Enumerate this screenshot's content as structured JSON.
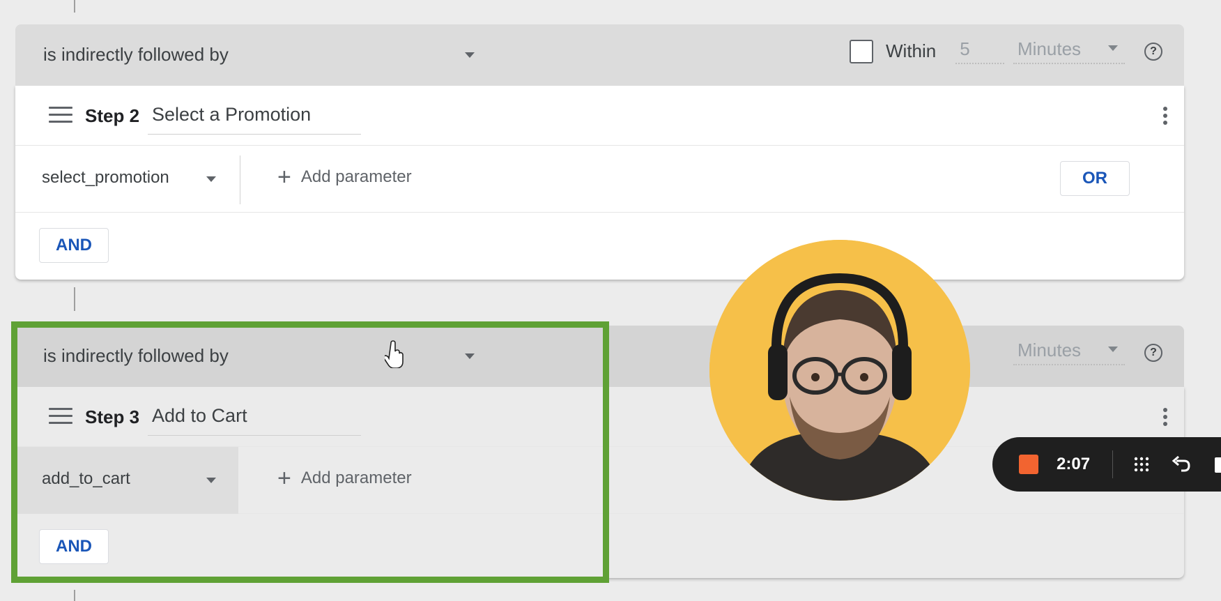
{
  "block1": {
    "condition": "is indirectly followed by",
    "within_label": "Within",
    "within_value": "5",
    "unit": "Minutes",
    "help": "?",
    "step_label": "Step 2",
    "step_name": "Select a Promotion",
    "event": "select_promotion",
    "add_parameter": "Add parameter",
    "or_label": "OR",
    "and_label": "AND"
  },
  "block2": {
    "condition": "is indirectly followed by",
    "unit": "Minutes",
    "help": "?",
    "step_label": "Step 3",
    "step_name": "Add to Cart",
    "event": "add_to_cart",
    "add_parameter": "Add parameter",
    "and_label": "AND"
  },
  "recorder": {
    "time": "2:07"
  },
  "colors": {
    "highlight": "#5fa135",
    "link_blue": "#1a56b8",
    "record_button": "#f26430",
    "webcam_background": "#f6c049"
  }
}
